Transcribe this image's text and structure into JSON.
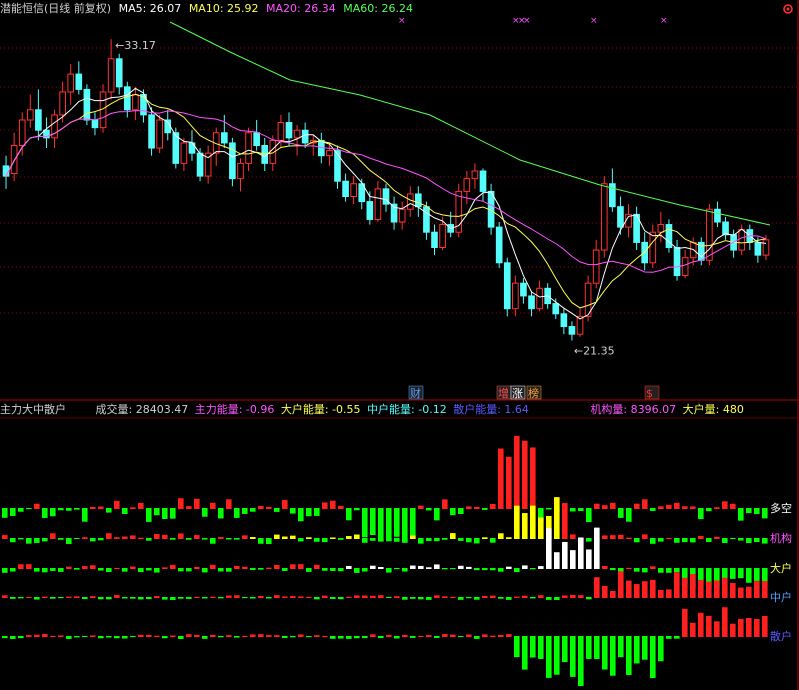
{
  "header": {
    "title": "潜能恒信(日线 前复权)",
    "ma5": "MA5: 26.07",
    "ma10": "MA10: 25.92",
    "ma20": "MA20: 26.34",
    "ma60": "MA60: 26.24"
  },
  "indicator_header": {
    "name": "主力大中散户",
    "volume": "成交量: 28403.47",
    "main_energy": "主力能量: -0.96",
    "big_energy": "大户能量: -0.55",
    "mid_energy": "中户能量: -0.12",
    "retail_energy": "散户能量: 1.64",
    "inst_volume": "机构量: 8396.07",
    "big_volume": "大户量: 480"
  },
  "colors": {
    "up": "#ff3333",
    "down": "#54fcfc",
    "ma5": "#ffffff",
    "ma10": "#ffff54",
    "ma20": "#ff54ff",
    "ma60": "#54ff54",
    "grid": "#8b0000",
    "bar_green": "#00ff00",
    "bar_red": "#ff2020",
    "bar_yellow": "#ffff00",
    "bar_white": "#ffffff"
  },
  "chart_data": {
    "type": "candlestick",
    "price_range": [
      20,
      34
    ],
    "high_marker": "33.17",
    "low_marker": "21.35",
    "event_markers": [
      "财",
      "增",
      "涨",
      "榜",
      "$"
    ],
    "x_markers": [
      "×",
      "×",
      "×",
      "×",
      "×",
      "×"
    ],
    "candles": [
      [
        28.2,
        28.6,
        27.3,
        27.8
      ],
      [
        27.9,
        29.5,
        27.6,
        29.0
      ],
      [
        29.0,
        30.3,
        28.6,
        30.0
      ],
      [
        30.0,
        31.0,
        29.7,
        30.4
      ],
      [
        30.4,
        31.2,
        29.2,
        29.6
      ],
      [
        29.6,
        30.1,
        28.9,
        29.3
      ],
      [
        29.3,
        30.4,
        28.9,
        30.2
      ],
      [
        30.2,
        31.5,
        29.9,
        31.1
      ],
      [
        31.1,
        32.2,
        30.6,
        31.8
      ],
      [
        31.8,
        32.3,
        31.0,
        31.2
      ],
      [
        31.2,
        31.4,
        29.8,
        30.0
      ],
      [
        30.0,
        30.3,
        29.4,
        29.7
      ],
      [
        29.7,
        31.4,
        29.5,
        31.1
      ],
      [
        31.1,
        33.17,
        30.8,
        32.4
      ],
      [
        32.4,
        32.6,
        31.0,
        31.3
      ],
      [
        31.3,
        31.5,
        30.1,
        30.4
      ],
      [
        30.4,
        31.3,
        30.0,
        31.0
      ],
      [
        31.0,
        31.2,
        29.9,
        30.2
      ],
      [
        30.2,
        30.5,
        28.6,
        28.9
      ],
      [
        28.9,
        30.2,
        28.7,
        30.0
      ],
      [
        30.0,
        30.4,
        29.2,
        29.5
      ],
      [
        29.5,
        29.7,
        28.1,
        28.3
      ],
      [
        28.3,
        29.3,
        28.0,
        29.1
      ],
      [
        29.1,
        29.6,
        28.4,
        28.7
      ],
      [
        28.7,
        28.9,
        27.6,
        27.8
      ],
      [
        27.8,
        29.0,
        27.5,
        28.7
      ],
      [
        28.7,
        29.7,
        28.2,
        29.5
      ],
      [
        29.5,
        30.2,
        28.9,
        29.1
      ],
      [
        29.1,
        29.3,
        27.4,
        27.7
      ],
      [
        27.7,
        28.5,
        27.2,
        28.3
      ],
      [
        28.3,
        29.7,
        28.0,
        29.5
      ],
      [
        29.5,
        30.0,
        28.8,
        29.0
      ],
      [
        29.0,
        29.3,
        28.0,
        28.3
      ],
      [
        28.3,
        29.4,
        28.0,
        29.2
      ],
      [
        29.2,
        30.2,
        28.9,
        29.9
      ],
      [
        29.9,
        30.3,
        29.0,
        29.3
      ],
      [
        29.3,
        29.8,
        28.6,
        29.6
      ],
      [
        29.6,
        29.9,
        28.9,
        29.1
      ],
      [
        29.1,
        29.4,
        28.6,
        29.2
      ],
      [
        29.2,
        29.5,
        28.3,
        28.6
      ],
      [
        28.6,
        29.1,
        28.2,
        28.8
      ],
      [
        28.8,
        29.0,
        27.3,
        27.6
      ],
      [
        27.6,
        27.9,
        26.8,
        27.0
      ],
      [
        27.0,
        27.8,
        26.7,
        27.5
      ],
      [
        27.5,
        27.7,
        26.5,
        26.8
      ],
      [
        26.8,
        27.2,
        25.9,
        26.1
      ],
      [
        26.1,
        27.6,
        26.0,
        27.3
      ],
      [
        27.3,
        27.5,
        26.4,
        26.7
      ],
      [
        26.7,
        27.0,
        25.7,
        26.0
      ],
      [
        26.0,
        26.8,
        25.7,
        26.5
      ],
      [
        26.5,
        27.4,
        26.2,
        27.1
      ],
      [
        27.1,
        27.4,
        26.2,
        26.6
      ],
      [
        26.6,
        26.8,
        25.3,
        25.6
      ],
      [
        25.6,
        25.9,
        24.7,
        25.0
      ],
      [
        25.0,
        26.2,
        24.9,
        25.9
      ],
      [
        25.9,
        26.4,
        25.4,
        25.6
      ],
      [
        25.6,
        27.5,
        25.4,
        27.2
      ],
      [
        27.2,
        28.0,
        26.7,
        27.7
      ],
      [
        27.7,
        28.3,
        27.3,
        28.0
      ],
      [
        28.0,
        28.1,
        26.8,
        27.2
      ],
      [
        27.2,
        27.5,
        25.5,
        25.8
      ],
      [
        25.8,
        26.0,
        24.2,
        24.4
      ],
      [
        24.4,
        24.6,
        22.3,
        22.6
      ],
      [
        22.6,
        23.9,
        22.3,
        23.6
      ],
      [
        23.6,
        23.8,
        22.8,
        23.1
      ],
      [
        23.1,
        23.3,
        22.3,
        22.6
      ],
      [
        22.6,
        23.7,
        22.5,
        23.4
      ],
      [
        23.4,
        23.6,
        22.6,
        22.8
      ],
      [
        22.8,
        23.0,
        22.2,
        22.4
      ],
      [
        22.4,
        22.6,
        21.6,
        21.9
      ],
      [
        21.9,
        22.1,
        21.35,
        21.6
      ],
      [
        21.6,
        22.6,
        21.5,
        22.3
      ],
      [
        22.3,
        23.9,
        22.1,
        23.6
      ],
      [
        23.6,
        25.3,
        23.4,
        24.9
      ],
      [
        24.9,
        27.8,
        24.6,
        27.5
      ],
      [
        27.5,
        28.1,
        26.4,
        26.6
      ],
      [
        26.6,
        27.0,
        25.5,
        25.8
      ],
      [
        25.8,
        26.7,
        25.4,
        26.3
      ],
      [
        26.3,
        26.6,
        24.9,
        25.2
      ],
      [
        25.2,
        25.6,
        24.1,
        24.4
      ],
      [
        24.4,
        25.9,
        24.2,
        25.6
      ],
      [
        25.6,
        26.4,
        25.2,
        25.9
      ],
      [
        25.9,
        26.1,
        24.8,
        25.0
      ],
      [
        25.0,
        25.3,
        23.7,
        23.9
      ],
      [
        23.9,
        24.9,
        23.8,
        24.6
      ],
      [
        24.6,
        25.4,
        24.3,
        25.2
      ],
      [
        25.2,
        25.4,
        24.3,
        24.5
      ],
      [
        24.5,
        26.7,
        24.3,
        26.5
      ],
      [
        26.5,
        26.8,
        25.8,
        26.0
      ],
      [
        26.0,
        26.2,
        25.3,
        25.5
      ],
      [
        25.5,
        25.7,
        24.6,
        24.9
      ],
      [
        24.9,
        25.9,
        24.7,
        25.7
      ],
      [
        25.7,
        25.9,
        24.9,
        25.2
      ],
      [
        25.2,
        25.4,
        24.4,
        24.7
      ],
      [
        24.7,
        25.5,
        24.5,
        25.3
      ]
    ],
    "indicator_rows": [
      "多空",
      "机构",
      "大户",
      "中户",
      "散户"
    ]
  }
}
